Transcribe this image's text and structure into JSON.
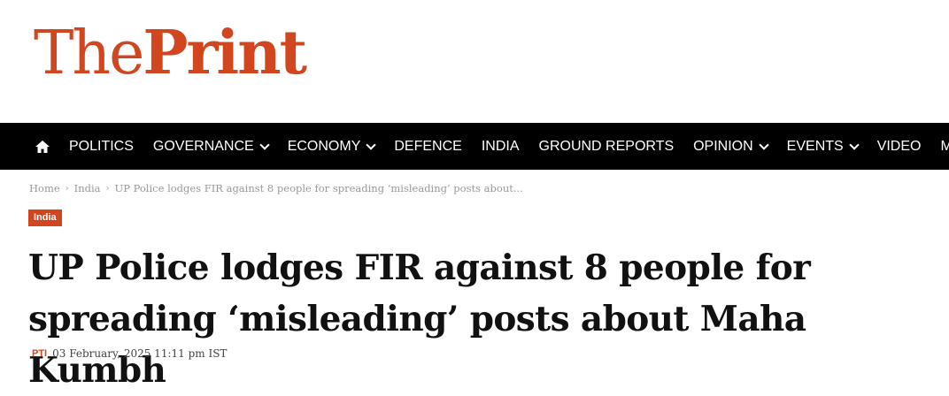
{
  "logo": {
    "the": "The",
    "print": "Print"
  },
  "nav": {
    "home_icon": "home-icon",
    "items": [
      {
        "label": "POLITICS",
        "dropdown": false
      },
      {
        "label": "GOVERNANCE",
        "dropdown": true
      },
      {
        "label": "ECONOMY",
        "dropdown": true
      },
      {
        "label": "DEFENCE",
        "dropdown": false
      },
      {
        "label": "INDIA",
        "dropdown": false
      },
      {
        "label": "GROUND REPORTS",
        "dropdown": false
      },
      {
        "label": "OPINION",
        "dropdown": true
      },
      {
        "label": "EVENTS",
        "dropdown": true
      },
      {
        "label": "VIDEO",
        "dropdown": false
      },
      {
        "label": "MORE",
        "dropdown": true
      }
    ]
  },
  "breadcrumb": {
    "home": "Home",
    "section": "India",
    "current": "UP Police lodges FIR against 8 people for spreading ‘misleading’ posts about..."
  },
  "category_badge": "India",
  "article": {
    "title": "UP Police lodges FIR against 8 people for spreading ‘misleading’ posts about Maha Kumbh",
    "author": "PTI",
    "date": "03 February, 2025 11:11 pm IST"
  },
  "colors": {
    "brand": "#d1451f",
    "nav_bg": "#000000",
    "text": "#111111"
  }
}
